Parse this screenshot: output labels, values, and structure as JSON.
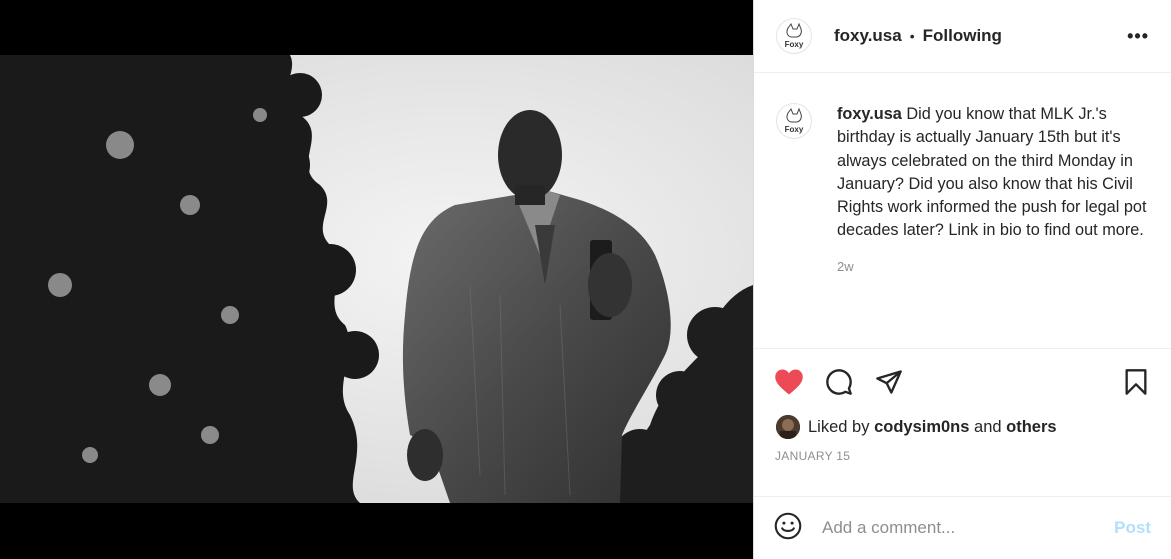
{
  "header": {
    "username": "foxy.usa",
    "separator": "•",
    "follow_status": "Following",
    "more_label": "•••"
  },
  "avatar": {
    "logo_text": "Foxy"
  },
  "caption": {
    "username": "foxy.usa",
    "text": "Did you know that MLK Jr.'s birthday is actually January 15th but it's always celebrated on the third Monday in January? Did you also know that his Civil Rights work informed the push for legal pot decades later? Link in bio to find out more.",
    "time_ago": "2w"
  },
  "actions": {
    "like_icon": "heart-filled-icon",
    "comment_icon": "comment-icon",
    "share_icon": "share-icon",
    "save_icon": "bookmark-icon",
    "like_color": "#ed4956"
  },
  "likes": {
    "prefix": "Liked by",
    "user": "codysim0ns",
    "and": "and",
    "others": "others"
  },
  "post_date": "JANUARY 15",
  "comment_box": {
    "placeholder": "Add a comment...",
    "post_label": "Post",
    "emoji_icon": "smiley-icon"
  }
}
